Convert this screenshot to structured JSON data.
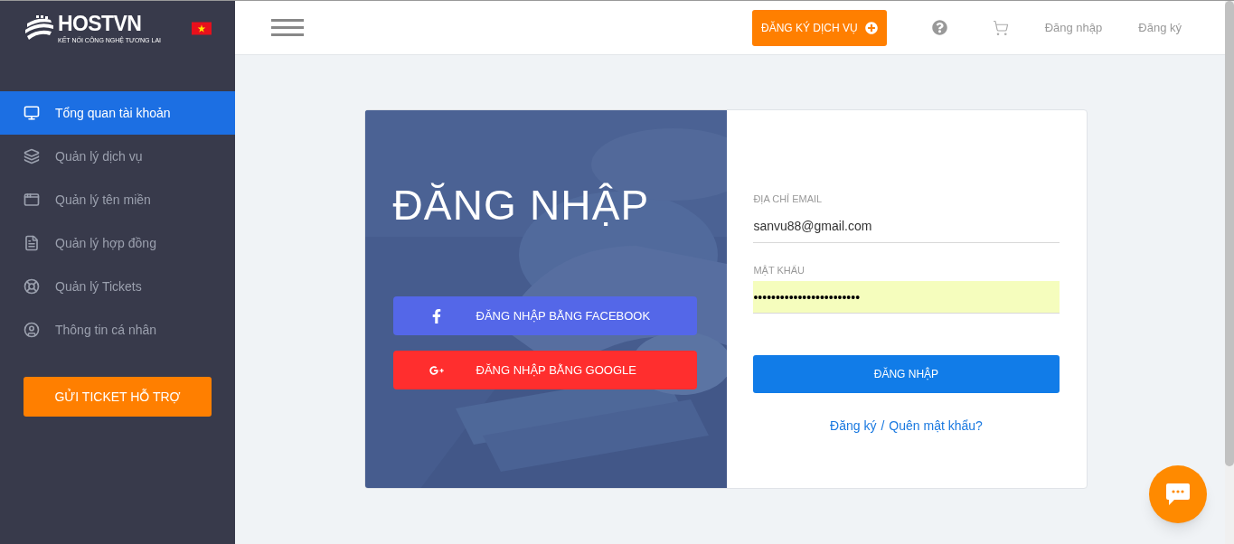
{
  "logo": {
    "name": "HOSTVN",
    "tagline": "KẾT NỐI CÔNG NGHỆ TƯƠNG LAI"
  },
  "sidebar": {
    "items": [
      {
        "label": "Tổng quan tài khoản",
        "kind": "monitor",
        "selected": true
      },
      {
        "label": "Quản lý dịch vụ",
        "kind": "layers",
        "selected": false
      },
      {
        "label": "Quản lý tên miền",
        "kind": "domain",
        "selected": false
      },
      {
        "label": "Quản lý hợp đồng",
        "kind": "contract",
        "selected": false
      },
      {
        "label": "Quản lý Tickets",
        "kind": "lifebuoy",
        "selected": false
      },
      {
        "label": "Thông tin cá nhân",
        "kind": "user",
        "selected": false
      }
    ],
    "support_button": "GỬI TICKET HỖ TRỢ"
  },
  "header": {
    "register_service_button": "ĐĂNG KÝ DỊCH VỤ",
    "links": [
      "Đăng nhập",
      "Đăng ký"
    ]
  },
  "login": {
    "title": "ĐĂNG NHẬP",
    "social_buttons": [
      {
        "kind": "facebook",
        "label": "ĐĂNG NHẬP BẰNG FACEBOOK"
      },
      {
        "kind": "google",
        "label": "ĐĂNG NHẬP BẰNG GOOGLE"
      }
    ],
    "fields": [
      {
        "label": "ĐỊA CHỈ EMAIL",
        "value": "sanvu88@gmail.com",
        "autofilled": false
      },
      {
        "label": "MẬT KHẨU",
        "value": "••••••••••••••••••••••••",
        "autofilled": true
      }
    ],
    "submit_button": "ĐĂNG NHẬP",
    "links": [
      "Đăng ký",
      "Quên mật khẩu?"
    ],
    "separator": "/"
  }
}
